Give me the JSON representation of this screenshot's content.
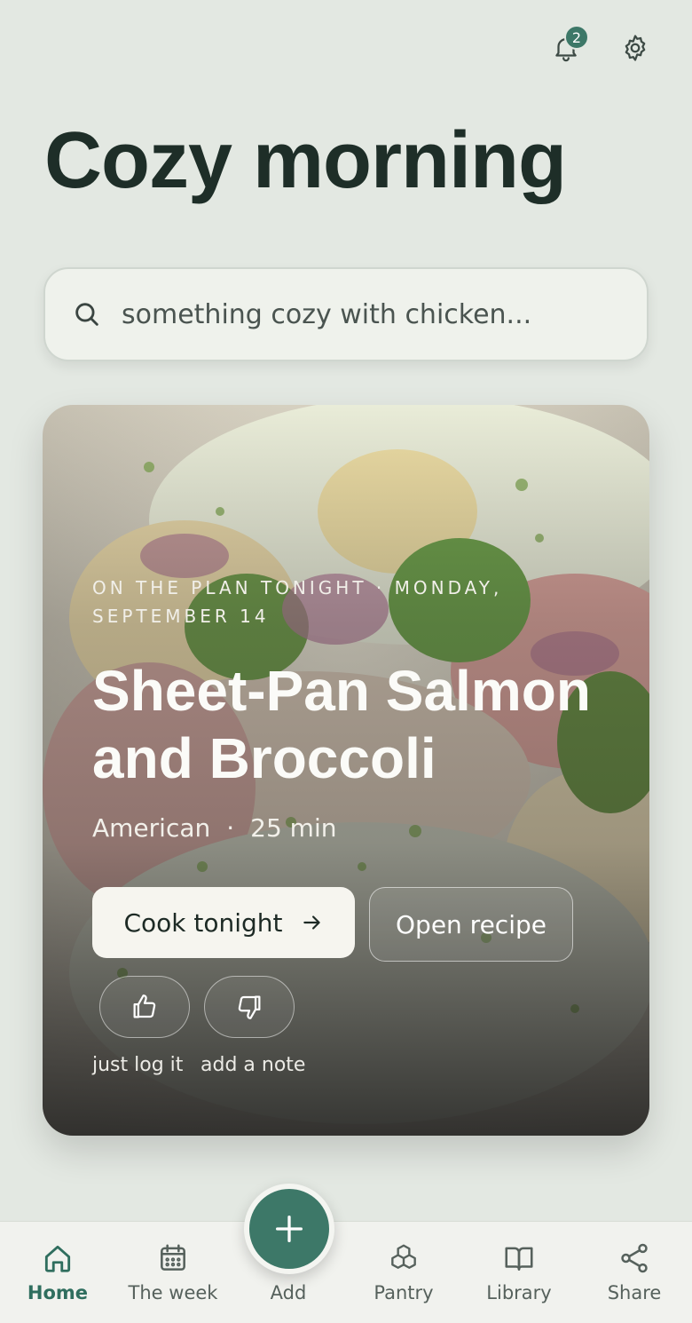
{
  "header": {
    "notification_count": "2",
    "title": "Cozy morning"
  },
  "search": {
    "placeholder": "something cozy with chicken..."
  },
  "card": {
    "eyebrow": "On the plan tonight · Monday, September 14",
    "title": "Sheet-Pan Salmon and Broccoli",
    "cuisine": "American",
    "separator": "·",
    "duration": "25 min",
    "primary_label": "Cook tonight",
    "secondary_label": "Open recipe",
    "like_caption": "just log it",
    "dislike_caption": "add a note"
  },
  "nav": {
    "items": [
      {
        "label": "Home",
        "icon": "home-icon",
        "active": true
      },
      {
        "label": "The week",
        "icon": "calendar-icon"
      },
      {
        "label": "Add",
        "icon": "plus-icon"
      },
      {
        "label": "Pantry",
        "icon": "boxes-icon"
      },
      {
        "label": "Library",
        "icon": "book-icon"
      },
      {
        "label": "Share",
        "icon": "share-icon"
      }
    ]
  },
  "colors": {
    "accent": "#3d7868",
    "background": "#e3e8e2"
  }
}
